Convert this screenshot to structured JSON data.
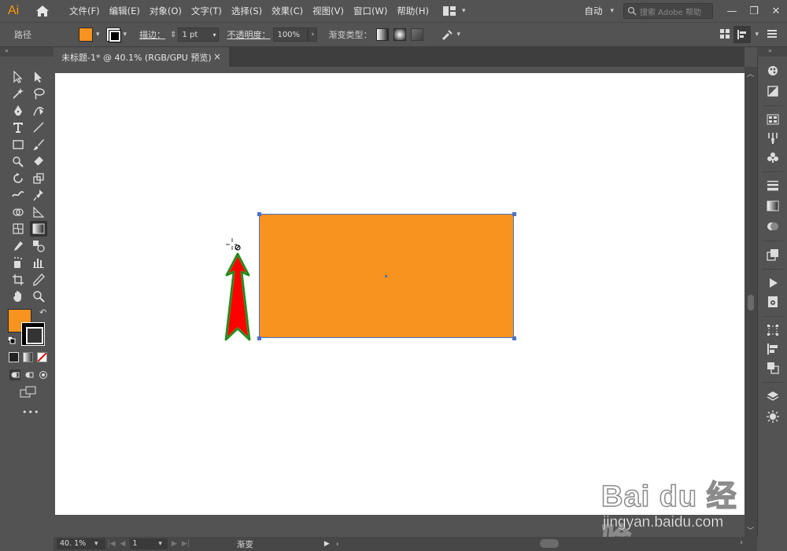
{
  "app": {
    "logo_text": "Ai",
    "workspace": "自动",
    "search_placeholder": "搜索 Adobe 帮助"
  },
  "menu": [
    "文件(F)",
    "编辑(E)",
    "对象(O)",
    "文字(T)",
    "选择(S)",
    "效果(C)",
    "视图(V)",
    "窗口(W)",
    "帮助(H)"
  ],
  "control_bar": {
    "selection_label": "路径",
    "fill_color": "#f7931e",
    "stroke_label": "描边：",
    "stroke_value": "1 pt",
    "opacity_label": "不透明度：",
    "opacity_value": "100%",
    "gradient_type_label": "渐变类型："
  },
  "document": {
    "tab_title": "未标题-1* @ 40.1% (RGB/GPU 预览)",
    "tab_close": "×"
  },
  "status_bar": {
    "zoom": "40. 1%",
    "page": "1",
    "panel_name": "渐变"
  },
  "artwork": {
    "rectangle_fill": "#f7931e",
    "selection_color": "#4a73c7",
    "annotation_arrow_color": "#ff0000"
  },
  "toolbox": {
    "more_tools": "•••",
    "tools": [
      "selection-tool",
      "direct-selection-tool",
      "magic-wand-tool",
      "lasso-tool",
      "pen-tool",
      "curvature-tool",
      "type-tool",
      "line-tool",
      "rectangle-tool",
      "paintbrush-tool",
      "shaper-tool",
      "eraser-tool",
      "rotate-tool",
      "scale-tool",
      "width-tool",
      "puppet-warp-tool",
      "shape-builder-tool",
      "perspective-grid-tool",
      "mesh-tool",
      "gradient-tool",
      "eyedropper-tool",
      "blend-tool",
      "symbol-sprayer-tool",
      "column-graph-tool",
      "artboard-tool",
      "slice-tool",
      "hand-tool",
      "zoom-tool"
    ]
  },
  "watermark": {
    "logo": "Bai du 经验",
    "url": "jingyan.baidu.com"
  }
}
